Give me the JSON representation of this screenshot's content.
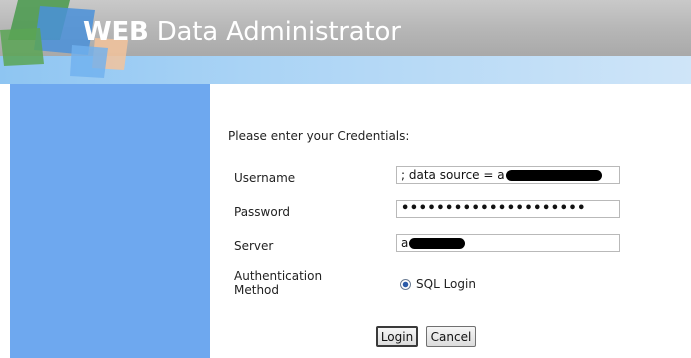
{
  "header": {
    "title_bold": "WEB",
    "title_rest": " Data Administrator"
  },
  "form": {
    "prompt": "Please enter your Credentials:",
    "username": {
      "label": "Username",
      "value": "; data source = a"
    },
    "password": {
      "label": "Password",
      "masked_value": "•••••••••••••••••••••"
    },
    "server": {
      "label": "Server",
      "value": "a"
    },
    "auth": {
      "label_line1": "Authentication",
      "label_line2": "Method",
      "option": "SQL Login",
      "selected": true
    },
    "login_label": "Login",
    "cancel_label": "Cancel"
  },
  "colors": {
    "sidebar": "#6ea8ef",
    "header_grey": "#b7b7b7",
    "header_blue": "#a9d3f5"
  }
}
